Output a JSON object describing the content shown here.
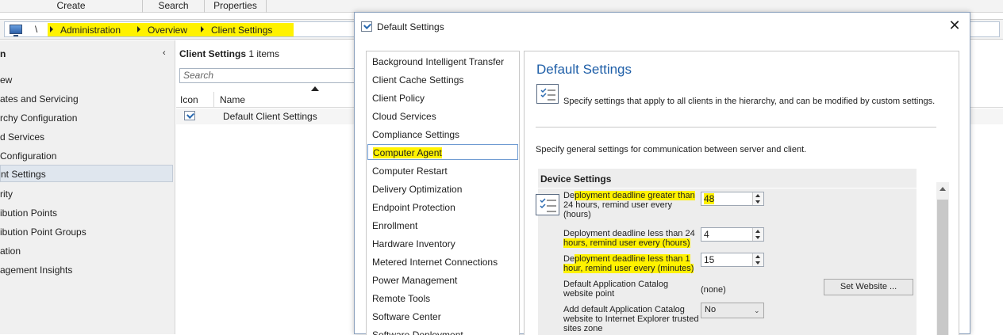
{
  "ribbon": {
    "tabs": [
      "Create",
      "Search",
      "Properties"
    ]
  },
  "addressbar": {
    "root": "\\",
    "breadcrumbs": [
      "Administration",
      "Overview",
      "Client Settings"
    ]
  },
  "nav": {
    "header": "n",
    "collapse_glyph": "‹",
    "items": [
      "ew",
      "ates and Servicing",
      "rchy Configuration",
      "d Services",
      "Configuration",
      "nt Settings",
      "rity",
      "ibution Points",
      "ibution Point Groups",
      "ation",
      "agement Insights"
    ],
    "selected_index": 5
  },
  "list": {
    "title": "Client Settings",
    "count": "1 items",
    "search_placeholder": "Search",
    "columns": [
      "Icon",
      "Name"
    ],
    "rows": [
      {
        "name": "Default Client Settings"
      }
    ]
  },
  "dialog": {
    "title": "Default Settings",
    "close_glyph": "✕",
    "sidebar": [
      "Background Intelligent Transfer",
      "Client Cache Settings",
      "Client Policy",
      "Cloud Services",
      "Compliance Settings",
      "Computer Agent",
      "Computer Restart",
      "Delivery Optimization",
      "Endpoint Protection",
      "Enrollment",
      "Hardware Inventory",
      "Metered Internet Connections",
      "Power Management",
      "Remote Tools",
      "Software Center",
      "Software Deployment"
    ],
    "sidebar_selected": "Computer Agent",
    "content": {
      "title": "Default Settings",
      "description": "Specify settings that apply to all clients in the hierarchy, and can be modified by custom settings.",
      "subheading": "Specify general settings for communication between server and client.",
      "section": "Device Settings",
      "settings": [
        {
          "label_pre": "De",
          "label_hl": "ployment deadline greater than",
          "label_post": "24 hours, remind user every (hours)",
          "value": "48"
        },
        {
          "label_pre": "Deployment deadline less than 24",
          "label_hl": "hours, remind user every (hours)",
          "label_post": "",
          "value": "4"
        },
        {
          "label_pre": "De",
          "label_hl": "ployment deadline less than 1 hour, remind user every (minutes)",
          "label_post": "",
          "value": "15"
        }
      ],
      "catalog_label": "Default Application Catalog website point",
      "catalog_value": "(none)",
      "set_website_label": "Set Website ...",
      "ie_zone_label": "Add default Application Catalog website to Internet Explorer trusted sites zone",
      "ie_zone_value": "No"
    }
  },
  "colors": {
    "highlight": "#fff200",
    "accent_title": "#1f5fa8"
  }
}
